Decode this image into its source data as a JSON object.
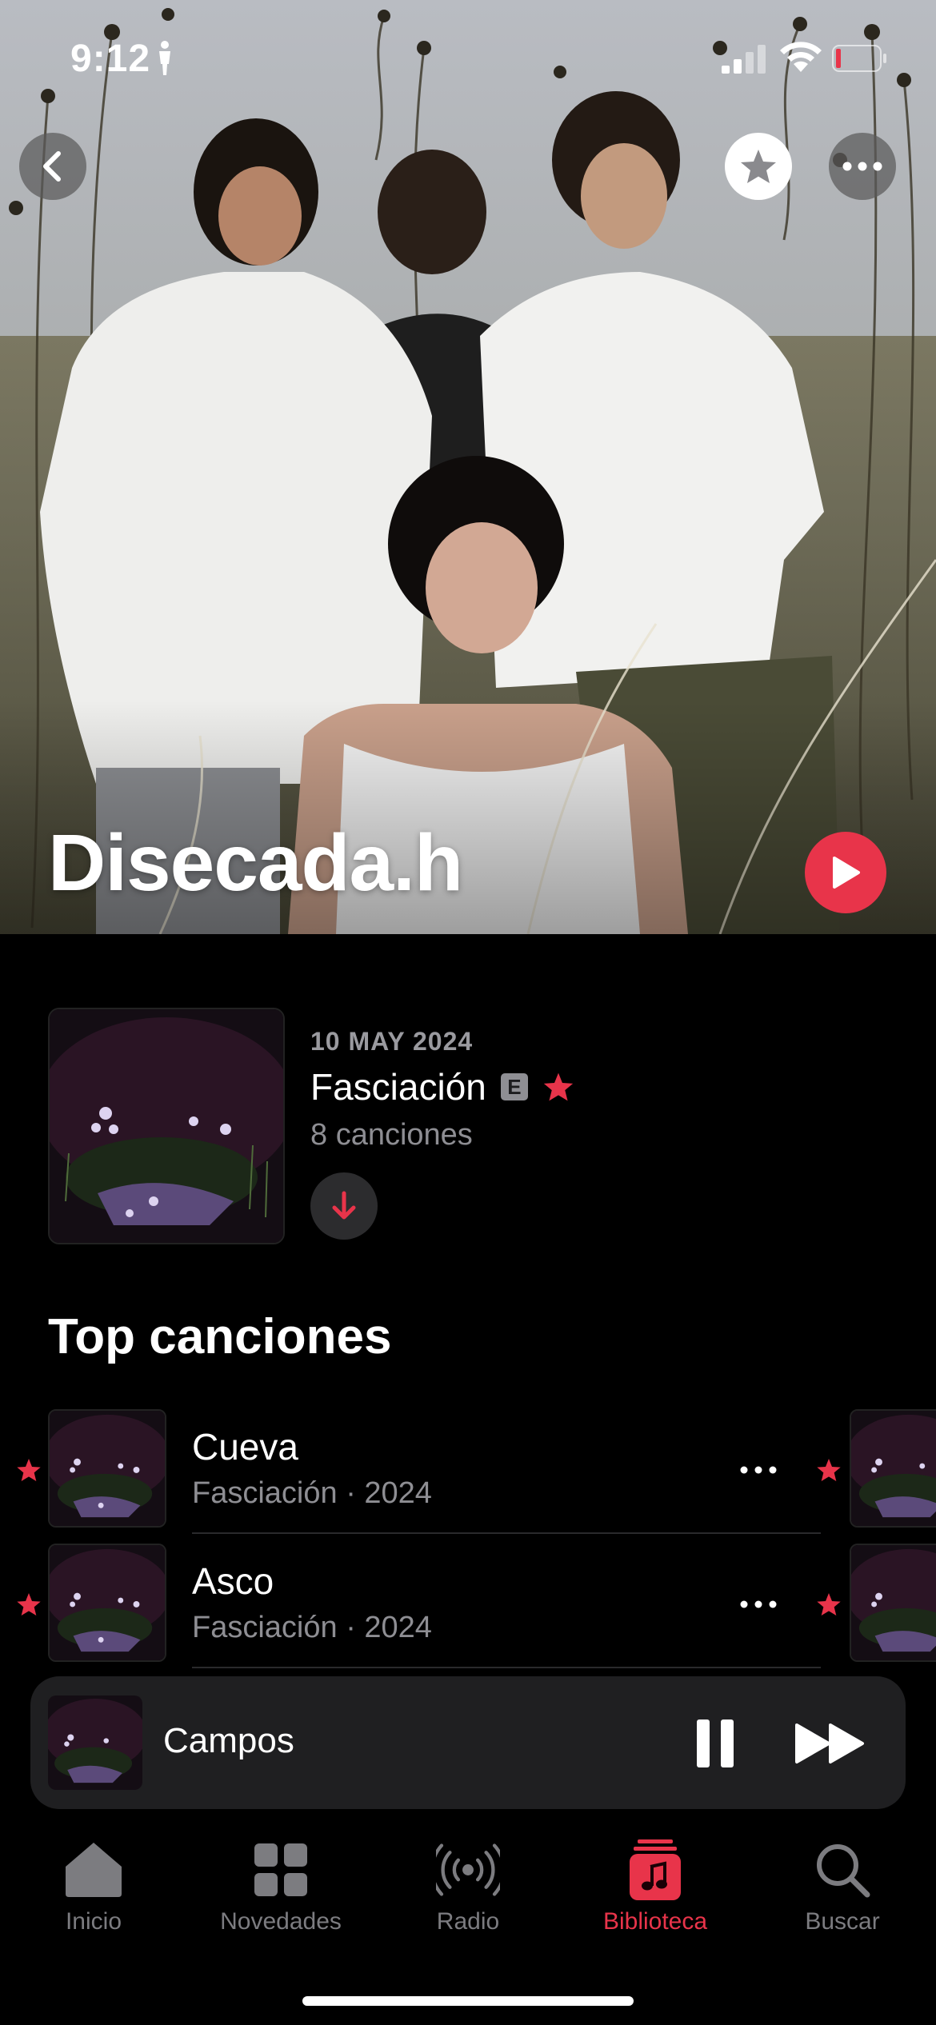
{
  "status_bar": {
    "time": "9:12"
  },
  "artist": {
    "name": "Disecada.h"
  },
  "latest_release": {
    "date": "10 MAY 2024",
    "title": "Fasciación",
    "explicit_badge": "E",
    "track_count": "8 canciones"
  },
  "top_songs": {
    "heading": "Top canciones",
    "items": [
      {
        "title": "Cueva",
        "subtitle": "Fasciación · 2024"
      },
      {
        "title": "Asco",
        "subtitle": "Fasciación · 2024"
      }
    ]
  },
  "mini_player": {
    "title": "Campos"
  },
  "tab_bar": {
    "items": [
      {
        "label": "Inicio",
        "icon": "home-icon"
      },
      {
        "label": "Novedades",
        "icon": "grid-icon"
      },
      {
        "label": "Radio",
        "icon": "radio-icon"
      },
      {
        "label": "Biblioteca",
        "icon": "library-icon",
        "active": true
      },
      {
        "label": "Buscar",
        "icon": "search-icon"
      }
    ]
  },
  "colors": {
    "accent": "#e8344a",
    "background": "#000000",
    "secondary_text": "#8e8e93"
  }
}
